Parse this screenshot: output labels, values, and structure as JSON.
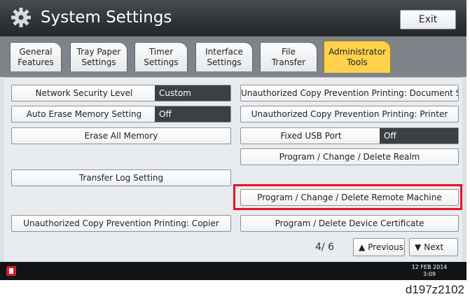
{
  "header": {
    "title": "System Settings",
    "exit_label": "Exit"
  },
  "tabs": [
    {
      "label": "General\nFeatures"
    },
    {
      "label": "Tray Paper\nSettings"
    },
    {
      "label": "Timer\nSettings"
    },
    {
      "label": "Interface\nSettings"
    },
    {
      "label": "File\nTransfer"
    },
    {
      "label": "Administrator\nTools",
      "active": true
    }
  ],
  "left_buttons": {
    "network_security": {
      "label": "Network Security Level",
      "value": "Custom"
    },
    "auto_erase": {
      "label": "Auto Erase Memory Setting",
      "value": "Off"
    },
    "erase_all": {
      "label": "Erase All Memory"
    },
    "transfer_log": {
      "label": "Transfer Log Setting"
    },
    "copy_prevention_copier": {
      "label": "Unauthorized Copy Prevention Printing: Copier"
    }
  },
  "right_buttons": {
    "copy_prevention_docserver": {
      "label": "Unauthorized Copy Prevention Printing: Document Server"
    },
    "copy_prevention_printer": {
      "label": "Unauthorized Copy Prevention Printing: Printer"
    },
    "fixed_usb": {
      "label": "Fixed USB Port",
      "value": "Off"
    },
    "realm": {
      "label": "Program / Change / Delete Realm"
    },
    "remote_machine": {
      "label": "Program / Change / Delete Remote Machine"
    },
    "device_certificate": {
      "label": "Program / Delete Device Certificate"
    }
  },
  "pagination": {
    "indicator": "4∕ 6",
    "previous_label": "Previous",
    "next_label": "Next"
  },
  "status": {
    "date_line1": "12 FEB  2014",
    "date_line2": "3:09"
  },
  "caption": "d197z2102",
  "colors": {
    "active_tab": "#ffd24a",
    "highlight": "#e3142a",
    "value_bg": "#3c3f44"
  },
  "icons": {
    "title": "gear-icon",
    "status": "alert-icon",
    "previous": "triangle-up-icon",
    "next": "triangle-down-icon"
  }
}
